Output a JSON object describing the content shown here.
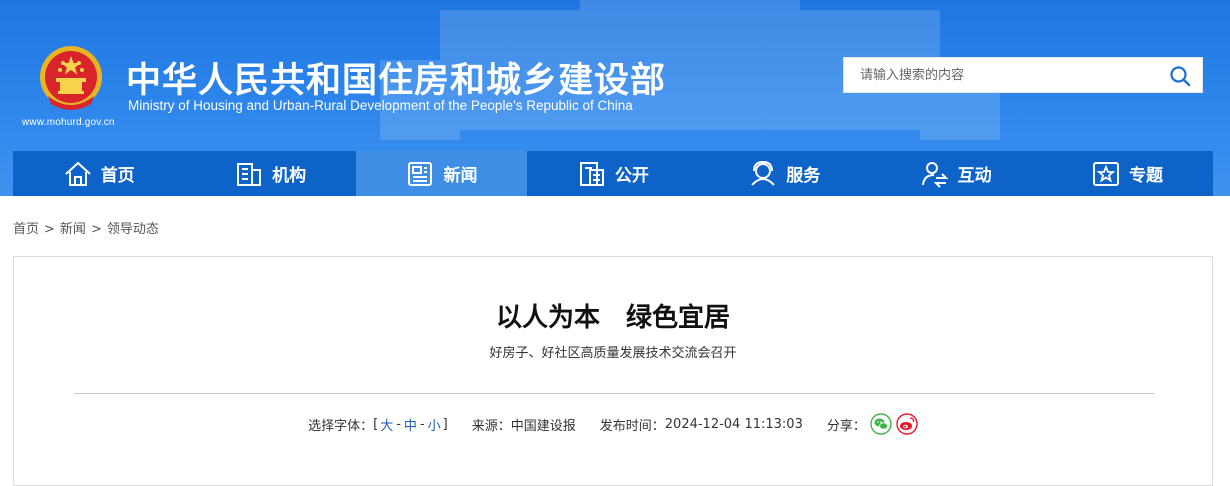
{
  "header": {
    "site_title": "中华人民共和国住房和城乡建设部",
    "site_subtitle": "Ministry of Housing and Urban-Rural Development of the People’s Republic of China",
    "site_url": "www.mohurd.gov.cn",
    "emblem_icon": "national-emblem-icon"
  },
  "search": {
    "placeholder": "请输入搜索的内容",
    "value": "",
    "button_icon": "search-icon"
  },
  "nav": {
    "items": [
      {
        "label": "首页",
        "icon": "home-icon",
        "active": false
      },
      {
        "label": "机构",
        "icon": "building-icon",
        "active": false
      },
      {
        "label": "新闻",
        "icon": "news-icon",
        "active": true
      },
      {
        "label": "公开",
        "icon": "document-icon",
        "active": false
      },
      {
        "label": "服务",
        "icon": "service-icon",
        "active": false
      },
      {
        "label": "互动",
        "icon": "interaction-icon",
        "active": false
      },
      {
        "label": "专题",
        "icon": "star-icon",
        "active": false
      }
    ]
  },
  "breadcrumb": {
    "items": [
      "首页",
      "新闻",
      "领导动态"
    ],
    "separator": ">"
  },
  "article": {
    "title": "以人为本　绿色宜居",
    "subtitle": "好房子、好社区高质量发展技术交流会召开",
    "font_size_label": "选择字体：",
    "font_size_open": "[",
    "font_size_close": "]",
    "font_sizes": [
      "大",
      "中",
      "小"
    ],
    "font_size_sep": "-",
    "source_label": "来源：",
    "source_value": "中国建设报",
    "publish_label": "发布时间：",
    "publish_value": "2024-12-04 11:13:03",
    "share_label": "分享：",
    "share_icons": [
      "wechat-icon",
      "weibo-icon"
    ]
  },
  "colors": {
    "header_blue": "#2e86ec",
    "nav_blue": "#0d63c8",
    "nav_active": "#3e8ee6",
    "link_blue": "#1a5fb4",
    "wechat_green": "#3bb54a",
    "weibo_red": "#e6162d"
  }
}
